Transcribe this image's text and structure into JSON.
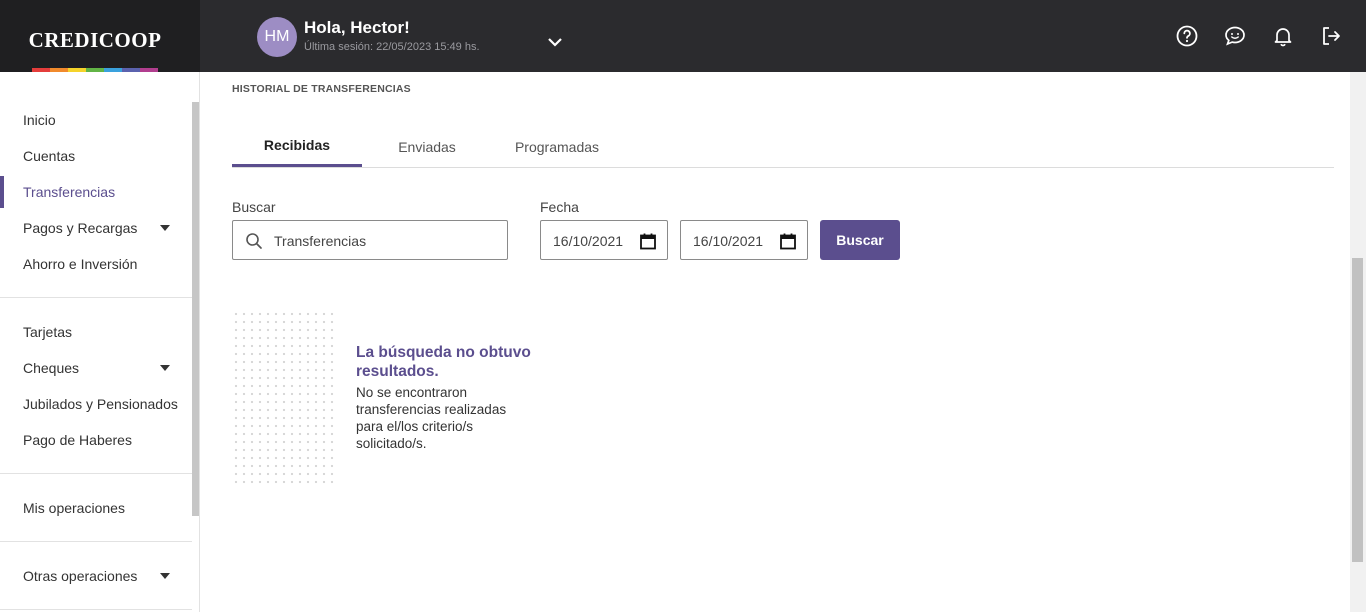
{
  "brand": {
    "logo_text": "CREDICOOP",
    "rainbow_colors": [
      "#e43d3b",
      "#f18a2c",
      "#f5d32a",
      "#62b446",
      "#3aa1dd",
      "#5b62ae",
      "#b13e8f"
    ]
  },
  "header": {
    "avatar_initials": "HM",
    "greeting": "Hola, Hector!",
    "last_session": "Última sesión: 22/05/2023 15:49 hs.",
    "icons": [
      "help-icon",
      "chat-icon",
      "bell-icon",
      "logout-icon"
    ]
  },
  "sidebar": {
    "items": [
      {
        "label": "Inicio"
      },
      {
        "label": "Cuentas"
      },
      {
        "label": "Transferencias",
        "active": true
      },
      {
        "label": "Pagos y Recargas",
        "expandable": true
      },
      {
        "label": "Ahorro e Inversión"
      },
      {
        "label": "Tarjetas"
      },
      {
        "label": "Cheques",
        "expandable": true
      },
      {
        "label": "Jubilados y Pensionados"
      },
      {
        "label": "Pago de Haberes"
      },
      {
        "label": "Mis operaciones"
      },
      {
        "label": "Otras operaciones",
        "expandable": true
      }
    ]
  },
  "main": {
    "section_title": "HISTORIAL DE TRANSFERENCIAS",
    "tabs": [
      {
        "label": "Recibidas",
        "active": true
      },
      {
        "label": "Enviadas"
      },
      {
        "label": "Programadas"
      }
    ],
    "search": {
      "label": "Buscar",
      "value": "Transferencias"
    },
    "date": {
      "label": "Fecha",
      "from": "16/10/2021",
      "to": "16/10/2021"
    },
    "search_button": "Buscar",
    "empty_state": {
      "title": "La búsqueda no obtuvo resultados.",
      "text": "No se encontraron transferencias realizadas para el/los criterio/s solicitado/s."
    }
  },
  "colors": {
    "accent": "#5b4e8e",
    "topbar": "#2b2b2e"
  }
}
